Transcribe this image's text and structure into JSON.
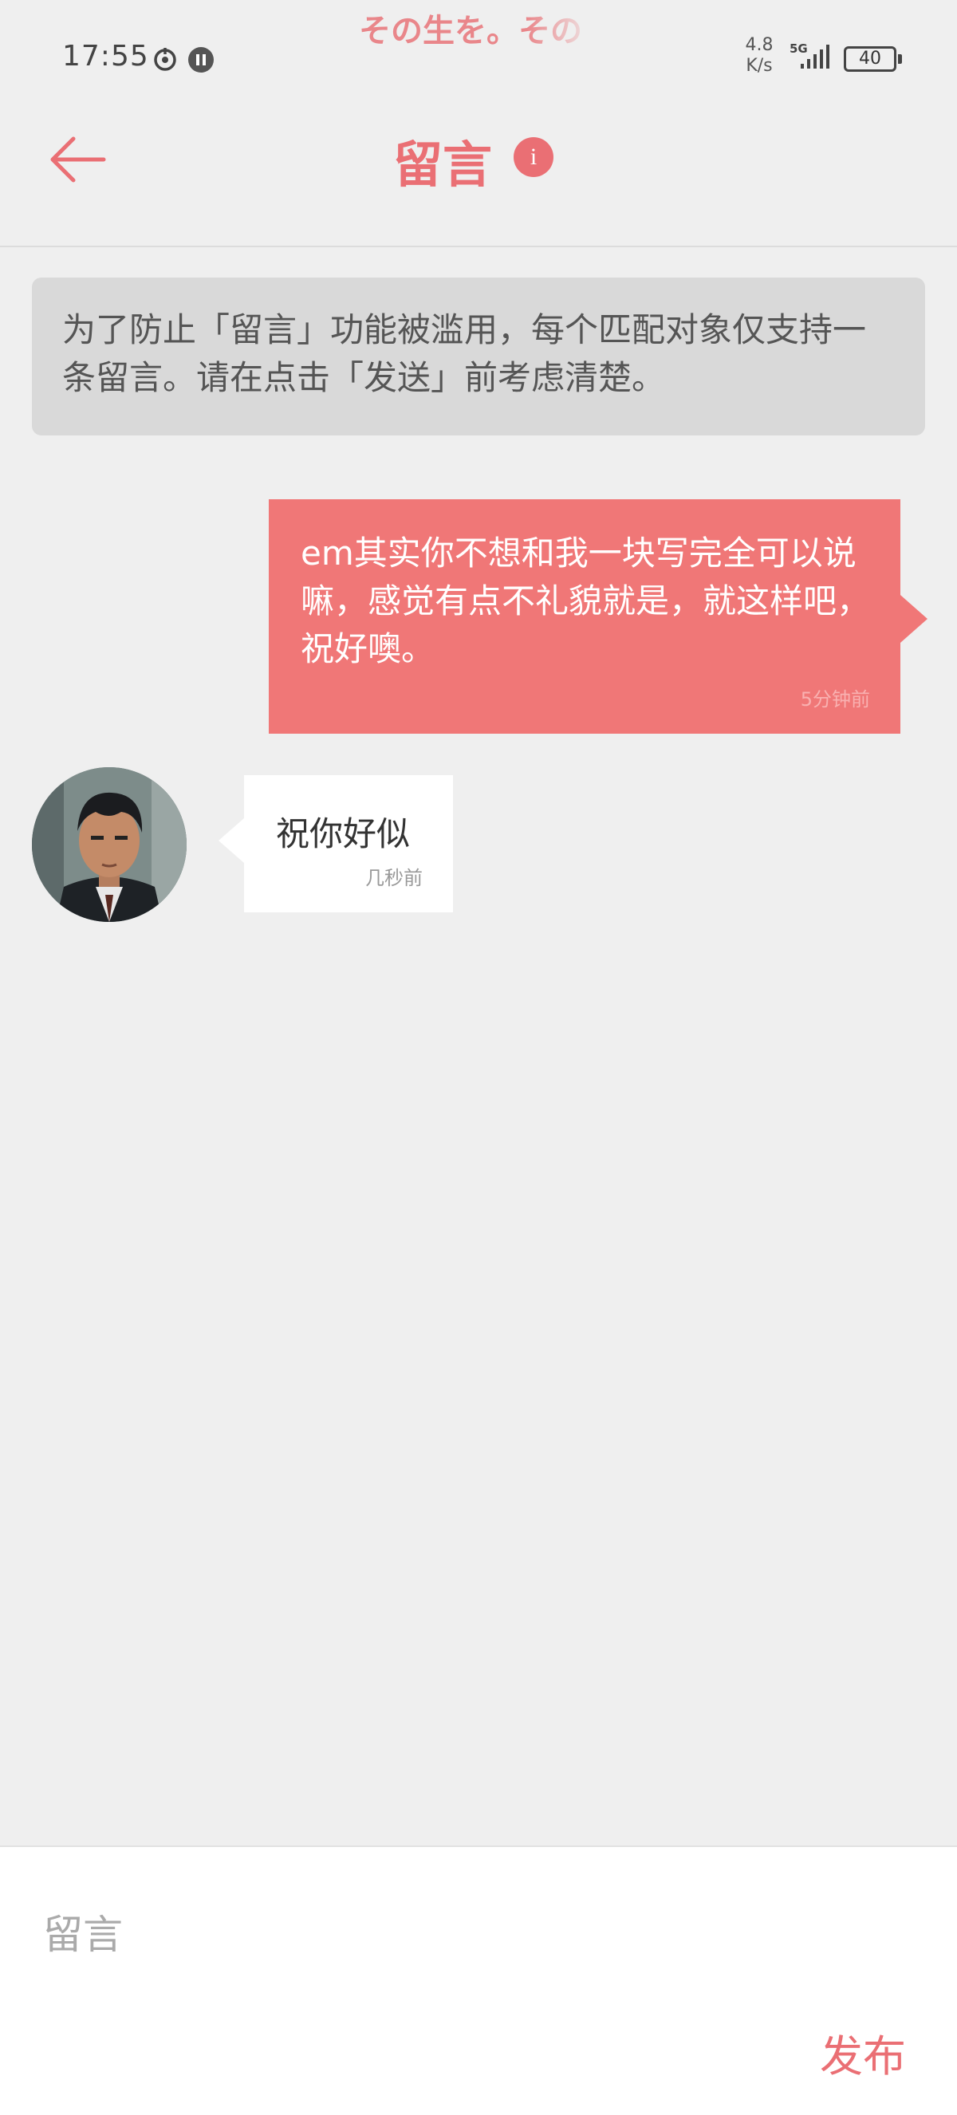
{
  "status_bar": {
    "time": "17:55",
    "marquee_text": "その生を。その",
    "net_speed_value": "4.8",
    "net_speed_unit": "K/s",
    "network_type": "5G",
    "battery": "40"
  },
  "header": {
    "title": "留言",
    "info_label": "i"
  },
  "notice": {
    "text": "为了防止「留言」功能被滥用，每个匹配对象仅支持一条留言。请在点击「发送」前考虑清楚。"
  },
  "messages": [
    {
      "direction": "outgoing",
      "text": "em其实你不想和我一块写完全可以说嘛，感觉有点不礼貌就是，就这样吧，祝好噢。",
      "time": "5分钟前"
    },
    {
      "direction": "incoming",
      "text": "祝你好似",
      "time": "几秒前"
    }
  ],
  "composer": {
    "placeholder": "留言",
    "value": "",
    "publish_label": "发布"
  },
  "colors": {
    "accent": "#ea6f74",
    "outgoing_bubble": "#f07777",
    "incoming_bubble": "#ffffff",
    "background": "#efefef",
    "notice_background": "#d9d9d9"
  }
}
